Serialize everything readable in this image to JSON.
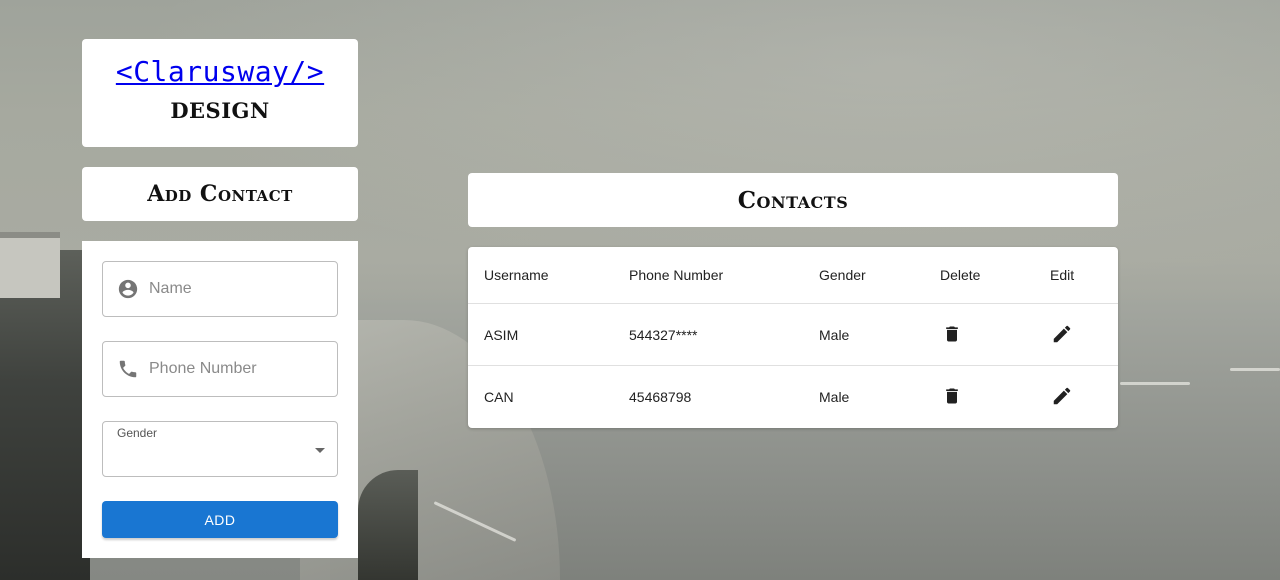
{
  "logo": {
    "link_text": "<Clarusway/>",
    "subtitle": "DESIGN"
  },
  "add_contact": {
    "title": "Add Contact",
    "name_placeholder": "Name",
    "phone_placeholder": "Phone Number",
    "gender_label": "Gender",
    "gender_value": "",
    "add_button": "ADD"
  },
  "contacts": {
    "title": "Contacts",
    "headers": [
      "Username",
      "Phone Number",
      "Gender",
      "Delete",
      "Edit"
    ],
    "rows": [
      {
        "username": "ASIM",
        "phone": "544327****",
        "gender": "Male"
      },
      {
        "username": "CAN",
        "phone": "45468798",
        "gender": "Male"
      }
    ]
  },
  "icons": {
    "name_field": "account-circle-icon",
    "phone_field": "phone-icon",
    "gender_select": "caret-down-icon",
    "delete": "trash-icon",
    "edit": "pencil-icon"
  },
  "colors": {
    "accent": "#1976d2",
    "link": "#0000ee"
  }
}
